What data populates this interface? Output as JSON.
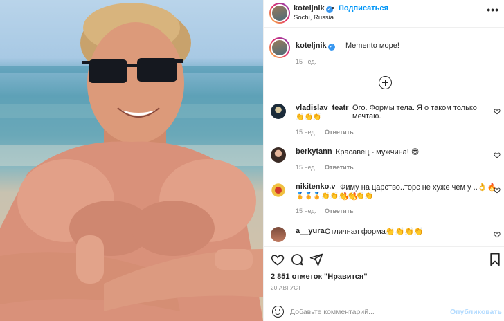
{
  "post": {
    "username": "koteljnik",
    "dot": "•",
    "follow_label": "Подписаться",
    "location": "Sochi, Russia",
    "more_label": "•••"
  },
  "caption": {
    "username": "koteljnik",
    "text": "Memento море!",
    "time": "15 нед."
  },
  "comments": [
    {
      "username": "vladislav_teatr",
      "text": "Ого. Формы тела. Я о таком только мечтаю.",
      "emoji_line": "👏👏👏",
      "time": "15 нед.",
      "reply": "Ответить"
    },
    {
      "username": "berkytann",
      "text": "Красавец - мужчина! 😍",
      "time": "15 нед.",
      "reply": "Ответить"
    },
    {
      "username": "nikitenko.v",
      "text": "Фиму на царство..торс не хуже чем у ..👌🔥🔥🔥",
      "emoji_line": "🏅🏅🏅👏👏👏👏👏👏",
      "time": "15 нед.",
      "reply": "Ответить"
    },
    {
      "username": "a__yura",
      "text": "Отличная форма👏👏👏👏",
      "time": "",
      "reply": ""
    }
  ],
  "engagement": {
    "likes": "2 851 отметок \"Нравится\"",
    "date": "20 АВГУСТ"
  },
  "add_comment": {
    "placeholder": "Добавьте комментарий...",
    "publish_label": "Опубликовать"
  },
  "icons": {
    "verified": "verified-badge-icon",
    "heart": "heart-icon",
    "comment": "comment-icon",
    "share": "share-icon",
    "bookmark": "bookmark-icon",
    "emoji": "emoji-icon",
    "load_more": "plus-circle-icon"
  },
  "colors": {
    "accent": "#0095f6",
    "muted": "#8e8e8e",
    "text": "#262626",
    "verified": "#3897f0"
  }
}
